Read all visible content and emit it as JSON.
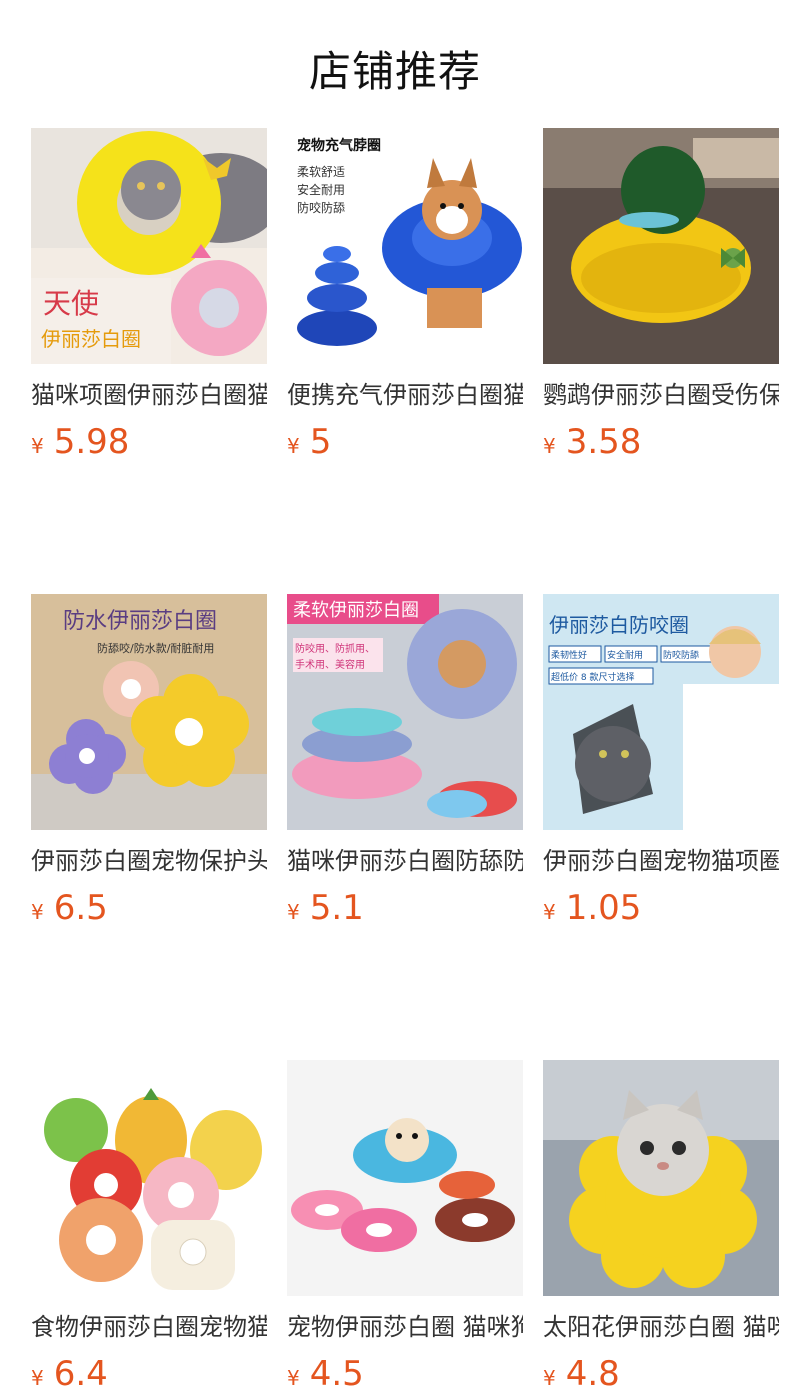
{
  "header": {
    "title": "店铺推荐"
  },
  "currency": "¥",
  "products": [
    {
      "name": "猫咪项圈伊丽莎白圈猫咪",
      "price": "5.98",
      "overlay": {
        "t1": "天使",
        "t2": "伊丽莎白圈"
      }
    },
    {
      "name": "便携充气伊丽莎白圈猫狗",
      "price": "5",
      "overlay": {
        "t1": "宠物充气脖圈",
        "t2": "柔软舒适",
        "t3": "安全耐用",
        "t4": "防咬防舔"
      }
    },
    {
      "name": "鹦鹉伊丽莎白圈受伤保护",
      "price": "3.58",
      "overlay": {}
    },
    {
      "name": "伊丽莎白圈宠物保护头套",
      "price": "6.5",
      "overlay": {
        "t1": "防水伊丽莎白圈",
        "t2": "防舔咬/防水款/耐脏耐用"
      }
    },
    {
      "name": "猫咪伊丽莎白圈防舔防抓",
      "price": "5.1",
      "overlay": {
        "t1": "柔软伊丽莎白圈",
        "t2": "防咬用、防抓用、",
        "t3": "手术用、美容用"
      }
    },
    {
      "name": "伊丽莎白圈宠物猫项圈防咬",
      "price": "1.05",
      "overlay": {
        "t1": "伊丽莎白防咬圈",
        "t2": "柔韧性好",
        "t3": "安全耐用",
        "t4": "防咬防舔",
        "t5": "超低价 8 款尺寸选择"
      }
    },
    {
      "name": "食物伊丽莎白圈宠物猫咪",
      "price": "6.4",
      "overlay": {}
    },
    {
      "name": "宠物伊丽莎白圈 猫咪狗狗",
      "price": "4.5",
      "overlay": {}
    },
    {
      "name": "太阳花伊丽莎白圈 猫咪",
      "price": "4.8",
      "overlay": {}
    }
  ],
  "colors": {
    "price": "#e4551f",
    "title": "#111111"
  }
}
